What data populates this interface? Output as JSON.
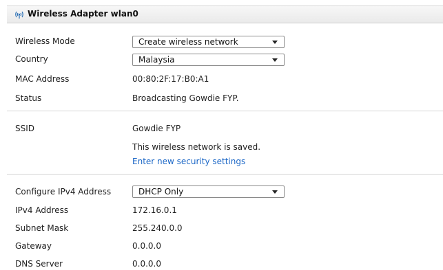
{
  "header": {
    "title": "Wireless Adapter wlan0"
  },
  "wireless": {
    "mode_label": "Wireless Mode",
    "mode_value": "Create wireless network",
    "country_label": "Country",
    "country_value": "Malaysia",
    "mac_label": "MAC Address",
    "mac_value": "00:80:2F:17:B0:A1",
    "status_label": "Status",
    "status_value": "Broadcasting Gowdie FYP."
  },
  "ssid": {
    "label": "SSID",
    "value": "Gowdie FYP",
    "saved_note": "This wireless network is saved.",
    "security_link": "Enter new security settings"
  },
  "ipv4": {
    "configure_label": "Configure IPv4 Address",
    "configure_value": "DHCP Only",
    "address_label": "IPv4 Address",
    "address_value": "172.16.0.1",
    "subnet_label": "Subnet Mask",
    "subnet_value": "255.240.0.0",
    "gateway_label": "Gateway",
    "gateway_value": "0.0.0.0",
    "dns_label": "DNS Server",
    "dns_value": "0.0.0.0"
  }
}
